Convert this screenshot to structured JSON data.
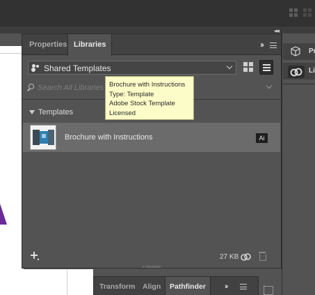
{
  "app_bar": {
    "arrange_icons": [
      "arrange-documents-icon",
      "workspace-switcher-icon"
    ]
  },
  "panel": {
    "tabs": [
      {
        "label": "Properties",
        "active": false
      },
      {
        "label": "Libraries",
        "active": true
      }
    ],
    "library_select": {
      "value": "Shared Templates"
    },
    "search": {
      "placeholder": "Search All Libraries"
    },
    "group": {
      "label": "Templates"
    },
    "item": {
      "label": "Brochure with Instructions",
      "badge": "Ai"
    },
    "tooltip": {
      "lines": [
        "Brochure with Instructions",
        "Type: Template",
        "Adobe Stock Template",
        "Licensed"
      ]
    },
    "footer": {
      "size": "27 KB"
    }
  },
  "right_dock": {
    "items": [
      {
        "label": "Pr"
      },
      {
        "label": "Lil"
      }
    ]
  },
  "bottom_panel": {
    "tabs": [
      {
        "label": "Transform",
        "active": false
      },
      {
        "label": "Align",
        "active": false
      },
      {
        "label": "Pathfinder",
        "active": true
      }
    ]
  },
  "colors": {
    "panel_bg": "#535353",
    "tab_bar_bg": "#424242",
    "selected_row": "#6b6b6b",
    "tooltip_bg": "#fcfcc8"
  }
}
